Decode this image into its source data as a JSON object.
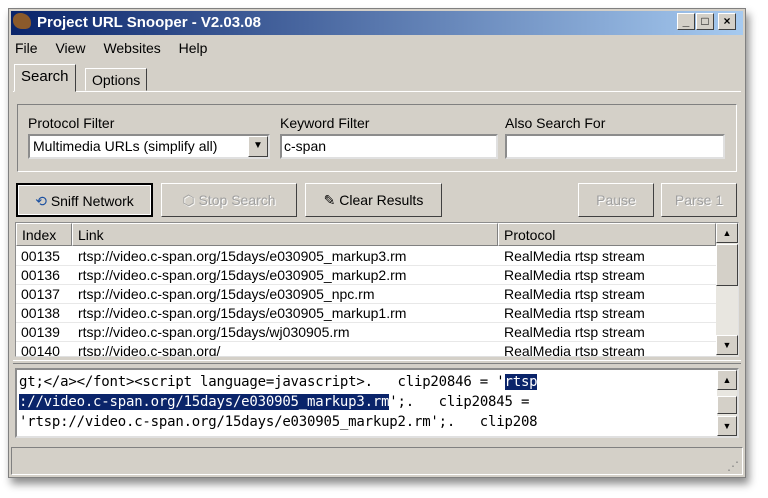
{
  "window": {
    "title": "Project URL Snooper - V2.03.08",
    "controls": [
      "_",
      "□",
      "×"
    ]
  },
  "menu": [
    "File",
    "View",
    "Websites",
    "Help"
  ],
  "tabs": [
    {
      "label": "Search",
      "active": true
    },
    {
      "label": "Options",
      "active": false
    }
  ],
  "filters": {
    "protocol_label": "Protocol Filter",
    "protocol_value": "Multimedia URLs (simplify all)",
    "keyword_label": "Keyword Filter",
    "keyword_value": "c-span",
    "also_label": "Also Search For",
    "also_value": ""
  },
  "buttons": {
    "sniff": "Sniff Network",
    "stop": "Stop Search",
    "clear": "Clear Results",
    "pause": "Pause",
    "parse": "Parse 1"
  },
  "table": {
    "columns": [
      "Index",
      "Link",
      "Protocol"
    ],
    "rows": [
      {
        "index": "00135",
        "link": "rtsp://video.c-span.org/15days/e030905_markup3.rm",
        "protocol": "RealMedia rtsp stream"
      },
      {
        "index": "00136",
        "link": "rtsp://video.c-span.org/15days/e030905_markup2.rm",
        "protocol": "RealMedia rtsp stream"
      },
      {
        "index": "00137",
        "link": "rtsp://video.c-span.org/15days/e030905_npc.rm",
        "protocol": "RealMedia rtsp stream"
      },
      {
        "index": "00138",
        "link": "rtsp://video.c-span.org/15days/e030905_markup1.rm",
        "protocol": "RealMedia rtsp stream"
      },
      {
        "index": "00139",
        "link": "rtsp://video.c-span.org/15days/wj030905.rm",
        "protocol": "RealMedia rtsp stream"
      },
      {
        "index": "00140",
        "link": "rtsp://video.c-span.org/",
        "protocol": "RealMedia rtsp stream"
      }
    ]
  },
  "source": {
    "line1_pre": "gt;</a></font><script language=javascript>.   clip20846 = '",
    "line1_sel": "rtsp",
    "line2_sel": "://video.c-span.org/15days/e030905_markup3.rm",
    "line2_post": "';.   clip20845 =",
    "line3": "'rtsp://video.c-span.org/15days/e030905_markup2.rm';.   clip208"
  },
  "status": ""
}
